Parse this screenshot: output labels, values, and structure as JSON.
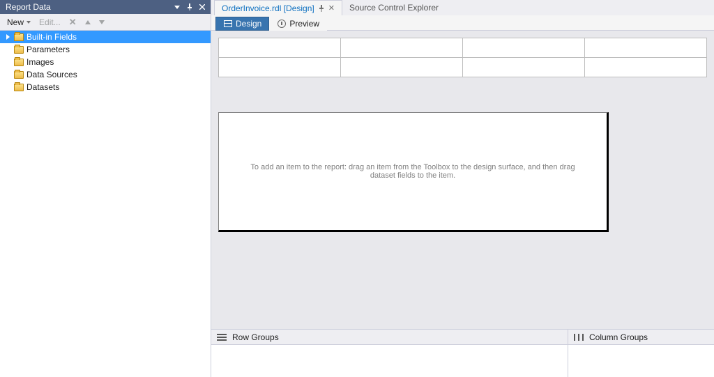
{
  "panel": {
    "title": "Report Data",
    "toolbar": {
      "new_label": "New",
      "edit_label": "Edit..."
    },
    "tree": [
      {
        "label": "Built-in Fields",
        "expandable": true,
        "selected": true
      },
      {
        "label": "Parameters",
        "expandable": false,
        "selected": false
      },
      {
        "label": "Images",
        "expandable": false,
        "selected": false
      },
      {
        "label": "Data Sources",
        "expandable": false,
        "selected": false
      },
      {
        "label": "Datasets",
        "expandable": false,
        "selected": false
      }
    ]
  },
  "doc_tabs": [
    {
      "label": "OrderInvoice.rdl [Design]",
      "active": true
    },
    {
      "label": "Source Control Explorer",
      "active": false
    }
  ],
  "mode_tabs": {
    "design": "Design",
    "preview": "Preview"
  },
  "canvas_hint": "To add an item to the report: drag an item from the Toolbox to the design surface, and then drag dataset fields to the item.",
  "groups": {
    "row_label": "Row Groups",
    "col_label": "Column Groups"
  }
}
